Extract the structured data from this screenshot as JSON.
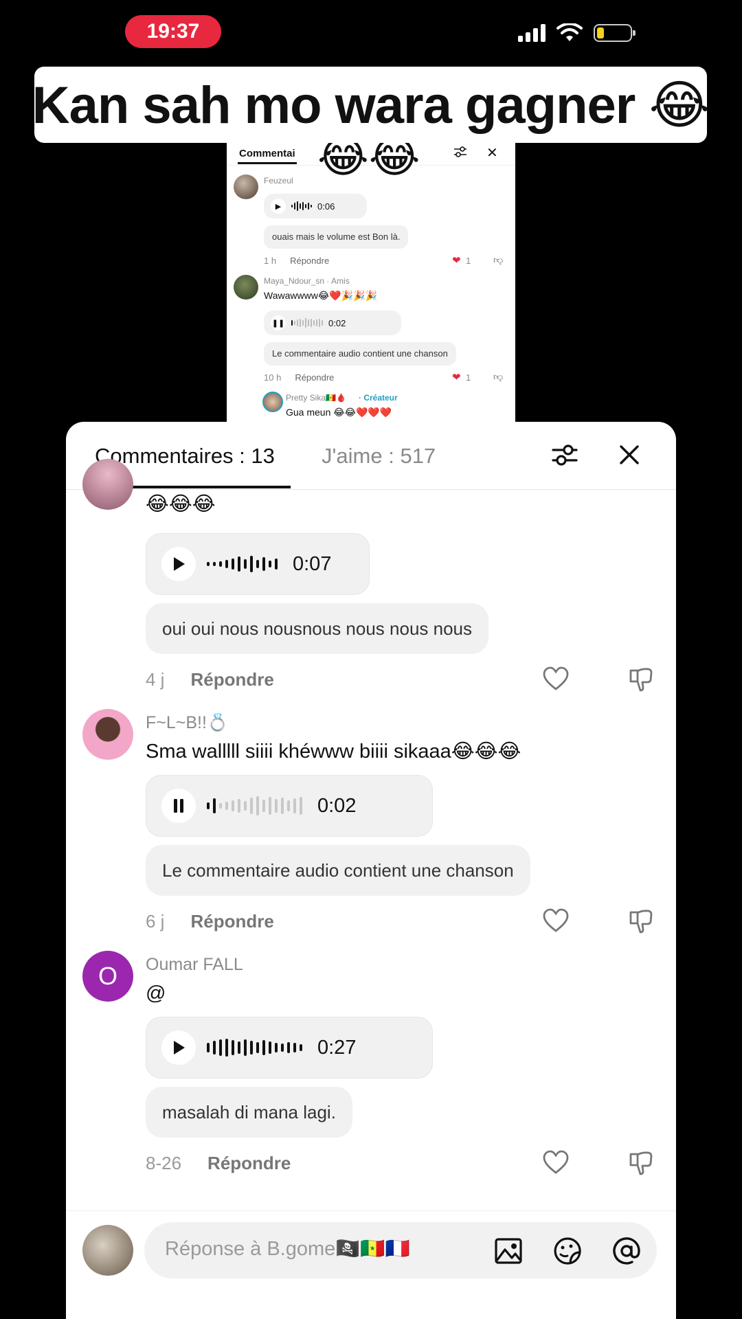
{
  "status": {
    "time": "19:37"
  },
  "caption": {
    "text": "Kan sah mo wara gagner 😂"
  },
  "embedded": {
    "tab": "Commentai",
    "emoji": "😂😂",
    "c1_user": "Feuzeul",
    "c1_duration": "0:06",
    "c1_transcript": "ouais mais le volume est Bon là.",
    "c1_time": "1 h",
    "c1_reply": "Répondre",
    "c1_likes": "1",
    "c2_user": "Maya_Ndour_sn · Amis",
    "c2_text": "Wawawwww😂❤️🎉🎉🎉",
    "c2_duration": "0:02",
    "c2_transcript": "Le commentaire audio contient une chanson",
    "c2_time": "10 h",
    "c2_reply": "Répondre",
    "c2_likes": "1",
    "r_user": "Pretty Sika🇸🇳🩸",
    "r_badge": "· Créateur",
    "r_text": "Gua meun 😂😂❤️❤️❤️"
  },
  "sheet": {
    "tab_comments": "Commentaires : 13",
    "tab_likes": "J'aime : 517",
    "comments": [
      {
        "text": "😂😂😂",
        "duration": "0:07",
        "transcript": "oui oui nous nousnous nous nous nous",
        "time": "4 j",
        "reply": "Répondre"
      },
      {
        "user": "F~L~B!!💍",
        "text": "Sma walllll siiii khéwww biiii sikaaa😂😂😂",
        "duration": "0:02",
        "transcript": "Le commentaire audio contient une chanson",
        "time": "6 j",
        "reply": "Répondre"
      },
      {
        "user": "Oumar FALL",
        "avatar_letter": "O",
        "text": "@",
        "duration": "0:27",
        "transcript": "masalah di mana lagi.",
        "time": "8-26",
        "reply": "Répondre"
      }
    ],
    "input_placeholder": "Réponse à B.gome🏴‍☠️🇸🇳🇫🇷"
  },
  "icons": {
    "play": "play-icon",
    "pause": "pause-icon",
    "heart": "heart-icon",
    "dislike": "thumbs-down-icon",
    "filter": "filter-icon",
    "close": "close-icon",
    "image": "image-icon",
    "sticker": "sticker-icon",
    "mention": "at-icon"
  },
  "colors": {
    "status_pill": "#e8283f",
    "heart_red": "#e8283f",
    "avatar_purple": "#9b27af",
    "creator_teal": "#20a0c4"
  }
}
